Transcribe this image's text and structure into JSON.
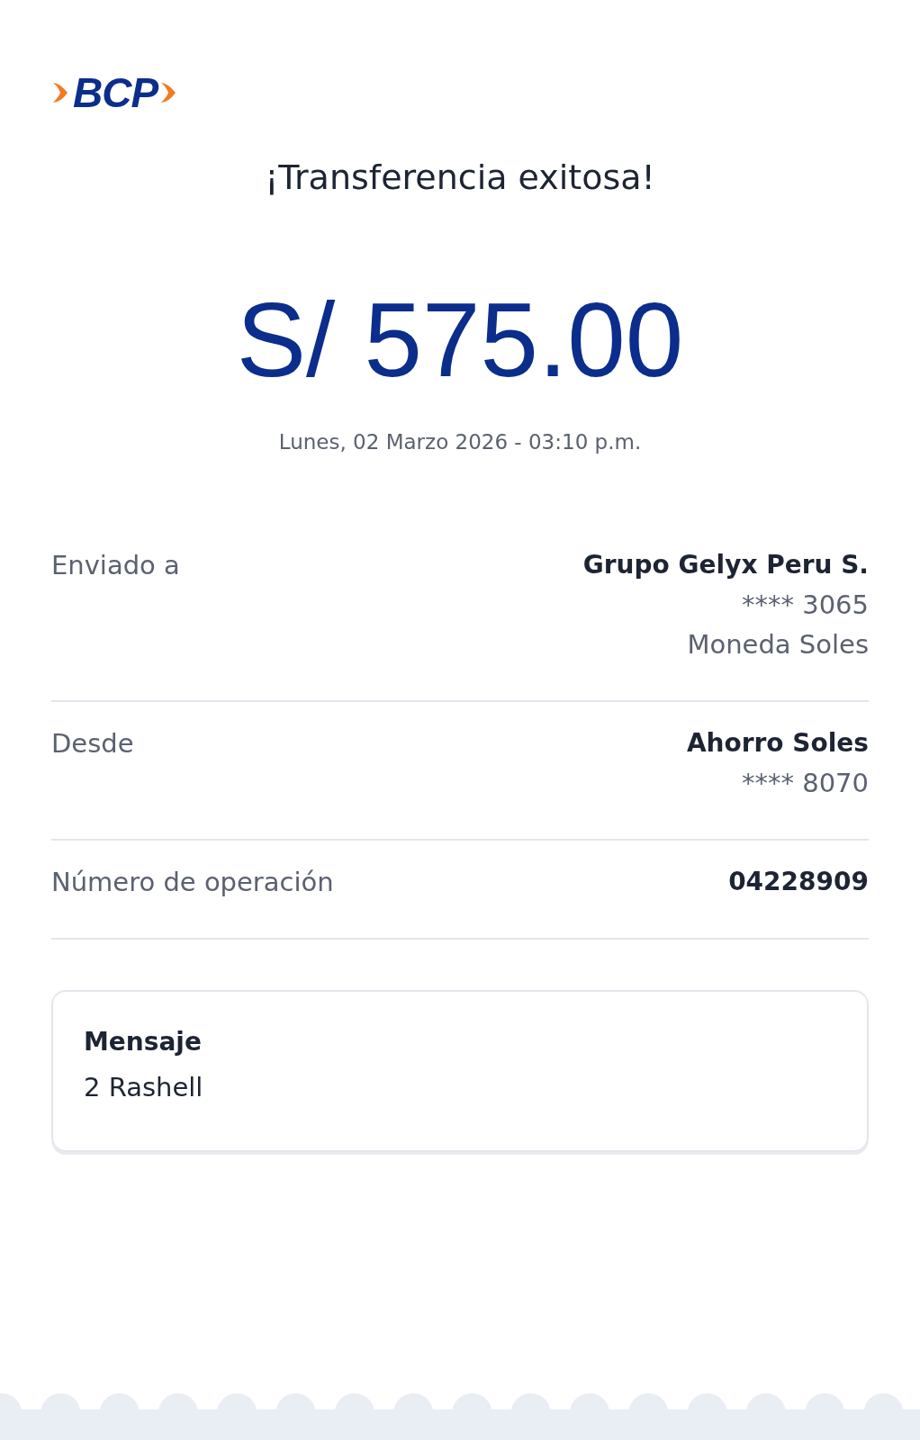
{
  "logo": {
    "text": "BCP"
  },
  "title": "¡Transferencia exitosa!",
  "amount": "S/ 575.00",
  "datetime": "Lunes, 02 Marzo 2026 - 03:10 p.m.",
  "details": [
    {
      "label": "Enviado a",
      "lines": [
        "Grupo Gelyx Peru S.",
        "**** 3065",
        "Moneda Soles"
      ]
    },
    {
      "label": "Desde",
      "lines": [
        "Ahorro Soles",
        "**** 8070"
      ]
    },
    {
      "label": "Número de operación",
      "lines": [
        "04228909"
      ]
    }
  ],
  "message": {
    "label": "Mensaje",
    "text": "2 Rashell"
  }
}
